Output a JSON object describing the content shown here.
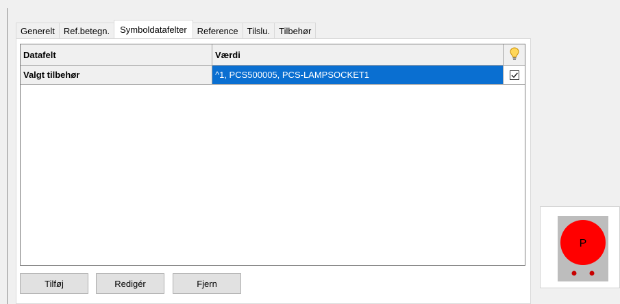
{
  "tabs": [
    {
      "label": "Generelt",
      "active": false
    },
    {
      "label": "Ref.betegn.",
      "active": false
    },
    {
      "label": "Symboldatafelter",
      "active": true
    },
    {
      "label": "Reference",
      "active": false
    },
    {
      "label": "Tilslu.",
      "active": false
    },
    {
      "label": "Tilbehør",
      "active": false
    }
  ],
  "grid": {
    "columns": {
      "field": "Datafelt",
      "value": "Værdi",
      "flag_icon": "lightbulb-icon"
    },
    "rows": [
      {
        "field": "Valgt tilbehør",
        "value": "^1, PCS500005, PCS-LAMPSOCKET1",
        "checked": true,
        "selected": true
      }
    ]
  },
  "buttons": {
    "add": "Tilføj",
    "edit": "Redigér",
    "remove": "Fjern"
  },
  "preview": {
    "symbol_letter": "P",
    "symbol_color": "#ff0000"
  }
}
